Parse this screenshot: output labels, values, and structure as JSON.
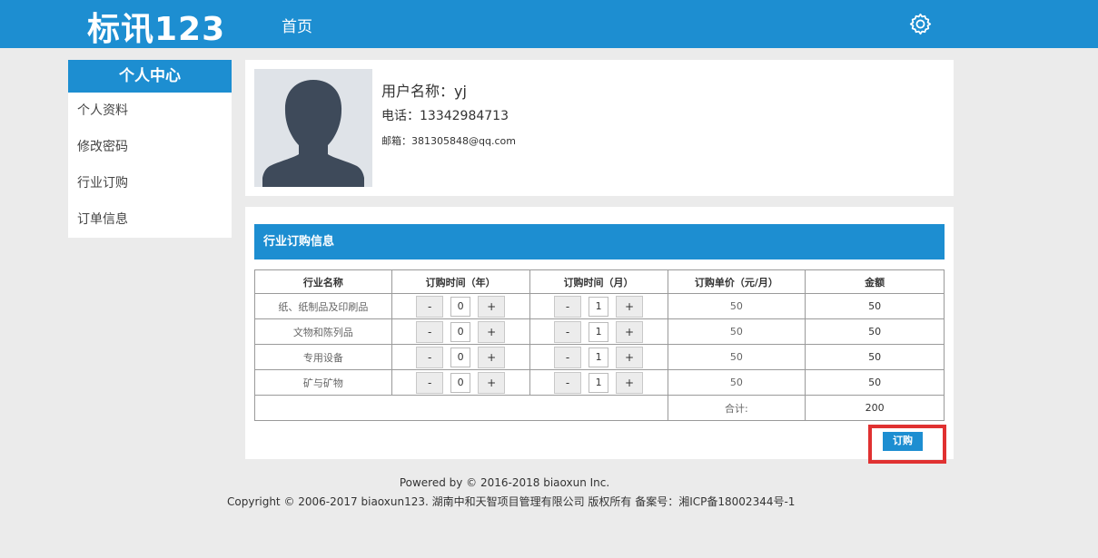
{
  "header": {
    "logo": "标讯123",
    "nav_home": "首页",
    "settings_icon": "gear-icon",
    "color": "#1d8ed1"
  },
  "sidebar": {
    "title": "个人中心",
    "items": [
      {
        "label": "个人资料"
      },
      {
        "label": "修改密码"
      },
      {
        "label": "行业订购"
      },
      {
        "label": "订单信息"
      }
    ]
  },
  "profile": {
    "username": "用户名称：yj",
    "phone": "电话：13342984713",
    "email": "邮箱：381305848@qq.com"
  },
  "orders": {
    "title": "行业订购信息",
    "columns": [
      "行业名称",
      "订购时间（年）",
      "订购时间（月）",
      "订购单价（元/月）",
      "金额"
    ],
    "minus": "-",
    "plus": "+",
    "rows": [
      {
        "name": "纸、纸制品及印刷品",
        "years": "0",
        "months": "1",
        "price": "50",
        "amount": "50"
      },
      {
        "name": "文物和陈列品",
        "years": "0",
        "months": "1",
        "price": "50",
        "amount": "50"
      },
      {
        "name": "专用设备",
        "years": "0",
        "months": "1",
        "price": "50",
        "amount": "50"
      },
      {
        "name": "矿与矿物",
        "years": "0",
        "months": "1",
        "price": "50",
        "amount": "50"
      }
    ],
    "total_label": "合计:",
    "total_value": "200",
    "order_button": "订购"
  },
  "footer": {
    "line1": "Powered by © 2016-2018 biaoxun Inc.",
    "line2": "Copyright © 2006-2017 biaoxun123. 湖南中和天智项目管理有限公司 版权所有  备案号：湘ICP备18002344号-1"
  }
}
